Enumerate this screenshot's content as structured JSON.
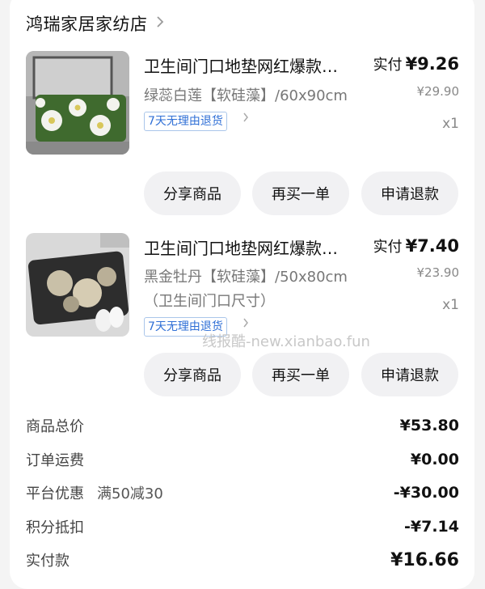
{
  "shop": {
    "name": "鸿瑞家居家纺店"
  },
  "items": [
    {
      "title": "卫生间门口地垫网红爆款…",
      "spec": "绿蕊白莲【软硅藻】/60x90cm",
      "spec2": "",
      "tag": "7天无理由退货",
      "pay_label": "实付",
      "pay_amount": "¥9.26",
      "original_price": "¥29.90",
      "quantity": "x1",
      "buttons": [
        "分享商品",
        "再买一单",
        "申请退款"
      ]
    },
    {
      "title": "卫生间门口地垫网红爆款…",
      "spec": "黑金牡丹【软硅藻】/50x80cm",
      "spec2": "（卫生间门口尺寸）",
      "tag": "7天无理由退货",
      "pay_label": "实付",
      "pay_amount": "¥7.40",
      "original_price": "¥23.90",
      "quantity": "x1",
      "buttons": [
        "分享商品",
        "再买一单",
        "申请退款"
      ]
    }
  ],
  "summary": {
    "goods_total_label": "商品总价",
    "goods_total": "¥53.80",
    "shipping_label": "订单运费",
    "shipping": "¥0.00",
    "platform_discount_label": "平台优惠",
    "platform_discount_promo": "满50减30",
    "platform_discount": "-¥30.00",
    "points_label": "积分抵扣",
    "points": "-¥7.14",
    "paid_label": "实付款",
    "paid": "¥16.66"
  },
  "watermark": "线报酷-new.xianbao.fun",
  "colors": {
    "tag_blue": "#2f6fd6",
    "button_bg": "#f1f1f3"
  }
}
